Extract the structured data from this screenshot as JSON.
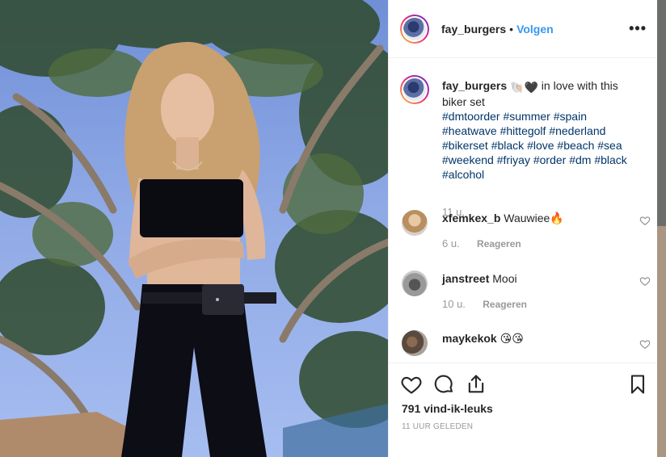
{
  "post": {
    "username": "fay_burgers",
    "separator": "•",
    "follow_label": "Volgen",
    "more_label": "•••"
  },
  "caption": {
    "username": "fay_burgers",
    "emoji": "🐚🖤",
    "text": " in love with this biker set",
    "hashtags": [
      "#dmtoorder",
      "#summer",
      "#spain",
      "#heatwave",
      "#hittegolf",
      "#nederland",
      "#bikerset",
      "#black",
      "#love",
      "#beach",
      "#sea",
      "#weekend",
      "#friyay",
      "#order",
      "#dm",
      "#black",
      "#alcohol"
    ],
    "time": "11 u."
  },
  "comments": [
    {
      "username": "xfemkex_b",
      "text": "Wauwiee🔥",
      "age": "6 u.",
      "reply_label": "Reageren"
    },
    {
      "username": "janstreet",
      "text": "Mooi",
      "age": "10 u.",
      "reply_label": "Reageren"
    },
    {
      "username": "maykekok",
      "text": "😘😘",
      "age": "",
      "reply_label": ""
    }
  ],
  "footer": {
    "likes": "791 vind-ik-leuks",
    "posted": "11 UUR GELEDEN"
  },
  "icons": {
    "like": "heart-icon",
    "comment": "comment-bubble-icon",
    "share": "share-upload-icon",
    "save": "bookmark-icon",
    "more": "more-options-icon"
  },
  "colors": {
    "follow": "#3897f0",
    "hashtag": "#003569",
    "muted": "#999999"
  }
}
